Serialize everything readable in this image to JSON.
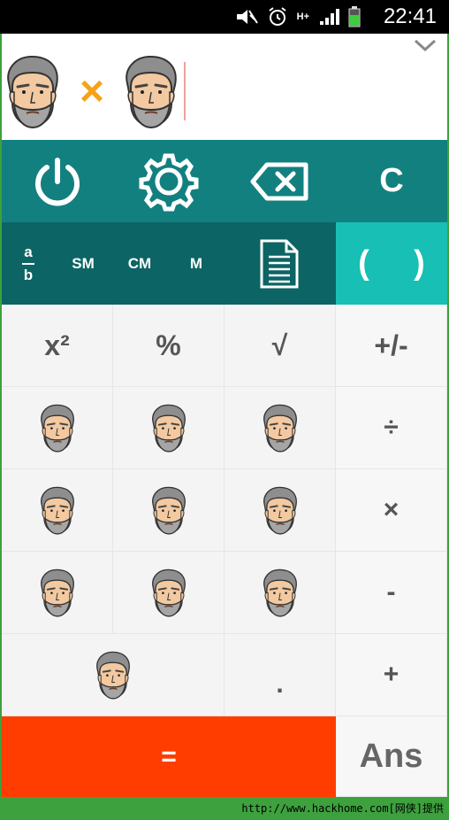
{
  "status": {
    "clock": "22:41",
    "network": "H+"
  },
  "display": {
    "expression_operator": "×"
  },
  "toolbar": {
    "power": "power",
    "settings": "settings",
    "backspace": "backspace",
    "clear": "C"
  },
  "modes": {
    "fraction_num": "a",
    "fraction_den": "b",
    "sm": "SM",
    "cm": "CM",
    "m": "M",
    "paren_open": "(",
    "paren_close": ")"
  },
  "keys": {
    "square": "x²",
    "percent": "%",
    "sqrt": "√",
    "plusminus": "+/-",
    "divide": "÷",
    "multiply": "×",
    "minus": "-",
    "plus": "+",
    "dot": ".",
    "equals": "=",
    "ans": "Ans"
  },
  "watermark": "http://www.hackhome.com[网侠]提供",
  "colors": {
    "toolbar": "#138080",
    "modes": "#0d6464",
    "paren": "#17bfb5",
    "equals": "#ff3d00",
    "operator": "#f5a21a"
  }
}
